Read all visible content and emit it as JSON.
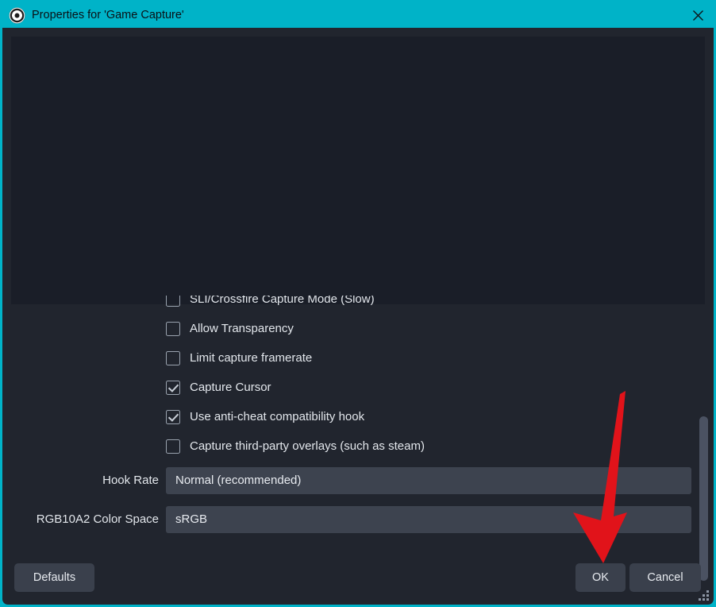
{
  "window": {
    "title": "Properties for 'Game Capture'",
    "app_icon": "obs-logo-icon",
    "close_icon": "close-icon",
    "titlebar_color": "#00b3c8",
    "accent_color": "#00b3c8",
    "background_color": "#21252e",
    "preview_color": "#1a1e28"
  },
  "preview": {
    "label": "source-preview-area"
  },
  "properties": {
    "checkboxes": [
      {
        "label": "SLI/Crossfire Capture Mode (Slow)",
        "checked": false
      },
      {
        "label": "Allow Transparency",
        "checked": false
      },
      {
        "label": "Limit capture framerate",
        "checked": false
      },
      {
        "label": "Capture Cursor",
        "checked": true
      },
      {
        "label": "Use anti-cheat compatibility hook",
        "checked": true
      },
      {
        "label": "Capture third-party overlays (such as steam)",
        "checked": false
      }
    ],
    "combos": [
      {
        "label": "Hook Rate",
        "value": "Normal (recommended)"
      },
      {
        "label": "RGB10A2 Color Space",
        "value": "sRGB"
      }
    ]
  },
  "footer": {
    "defaults_label": "Defaults",
    "ok_label": "OK",
    "cancel_label": "Cancel"
  },
  "annotation": {
    "arrow_color": "#e1131a",
    "arrow_target": "ok-button"
  }
}
